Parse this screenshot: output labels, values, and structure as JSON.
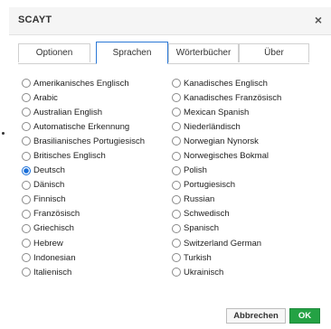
{
  "dialog": {
    "title": "SCAYT",
    "close_glyph": "×"
  },
  "tabs": [
    {
      "label": "Optionen",
      "active": false
    },
    {
      "label": "Sprachen",
      "active": true
    },
    {
      "label": "Wörterbücher",
      "active": false
    },
    {
      "label": "Über",
      "active": false
    }
  ],
  "languages": {
    "selected": "Deutsch",
    "left": [
      "Amerikanisches Englisch",
      "Arabic",
      "Australian English",
      "Automatische Erkennung",
      "Brasilianisches Portugiesisch",
      "Britisches Englisch",
      "Deutsch",
      "Dänisch",
      "Finnisch",
      "Französisch",
      "Griechisch",
      "Hebrew",
      "Indonesian",
      "Italienisch"
    ],
    "right": [
      "Kanadisches Englisch",
      "Kanadisches Französisch",
      "Mexican Spanish",
      "Niederländisch",
      "Norwegian Nynorsk",
      "Norwegisches Bokmal",
      "Polish",
      "Portugiesisch",
      "Russian",
      "Schwedisch",
      "Spanisch",
      "Switzerland German",
      "Turkish",
      "Ukrainisch"
    ]
  },
  "footer": {
    "cancel_label": "Abbrechen",
    "ok_label": "OK"
  },
  "colors": {
    "accent": "#2b78d6",
    "ok_button": "#24a244"
  }
}
